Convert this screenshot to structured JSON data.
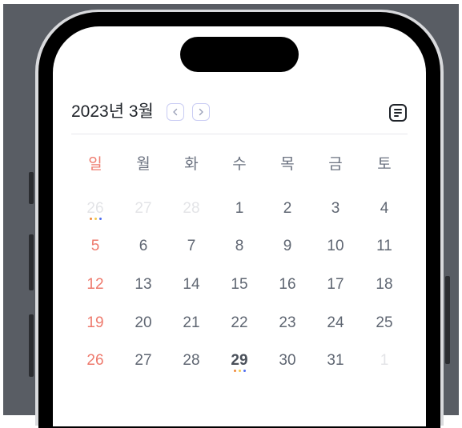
{
  "header": {
    "month_label": "2023년 3월",
    "prev_icon": "chevron-left-icon",
    "next_icon": "chevron-right-icon",
    "view_toggle_icon": "list-icon"
  },
  "weekdays": [
    "일",
    "월",
    "화",
    "수",
    "목",
    "금",
    "토"
  ],
  "weeks": [
    [
      {
        "d": "26",
        "type": "muted",
        "dots": true
      },
      {
        "d": "27",
        "type": "muted"
      },
      {
        "d": "28",
        "type": "muted"
      },
      {
        "d": "1"
      },
      {
        "d": "2"
      },
      {
        "d": "3"
      },
      {
        "d": "4"
      }
    ],
    [
      {
        "d": "5",
        "type": "sun"
      },
      {
        "d": "6"
      },
      {
        "d": "7"
      },
      {
        "d": "8"
      },
      {
        "d": "9"
      },
      {
        "d": "10"
      },
      {
        "d": "11"
      }
    ],
    [
      {
        "d": "12",
        "type": "sun"
      },
      {
        "d": "13"
      },
      {
        "d": "14"
      },
      {
        "d": "15"
      },
      {
        "d": "16"
      },
      {
        "d": "17"
      },
      {
        "d": "18"
      }
    ],
    [
      {
        "d": "19",
        "type": "sun"
      },
      {
        "d": "20"
      },
      {
        "d": "21"
      },
      {
        "d": "22"
      },
      {
        "d": "23"
      },
      {
        "d": "24"
      },
      {
        "d": "25"
      }
    ],
    [
      {
        "d": "26",
        "type": "sun"
      },
      {
        "d": "27"
      },
      {
        "d": "28"
      },
      {
        "d": "29",
        "type": "today",
        "dots": true
      },
      {
        "d": "30"
      },
      {
        "d": "31"
      },
      {
        "d": "1",
        "type": "muted"
      }
    ]
  ],
  "colors": {
    "accent_blue": "#4f6df0",
    "sunday_red": "#ee7a6d",
    "event_dots": [
      "#f08a3c",
      "#f3c94c",
      "#4f6df0"
    ]
  }
}
